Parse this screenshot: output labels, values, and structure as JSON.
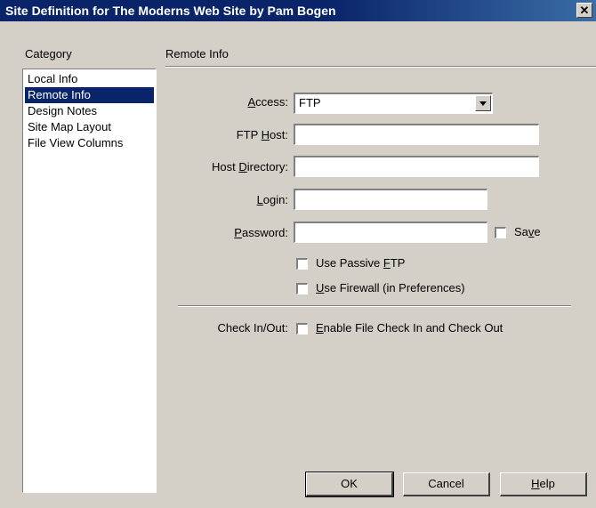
{
  "window": {
    "title": "Site Definition for The Moderns Web Site by Pam Bogen",
    "close_glyph": "✕"
  },
  "category": {
    "label": "Category",
    "items": [
      {
        "label": "Local Info",
        "selected": false
      },
      {
        "label": "Remote Info",
        "selected": true
      },
      {
        "label": "Design Notes",
        "selected": false
      },
      {
        "label": "Site Map Layout",
        "selected": false
      },
      {
        "label": "File View Columns",
        "selected": false
      }
    ]
  },
  "panel": {
    "title": "Remote Info",
    "access": {
      "label_pre": "",
      "label_key": "A",
      "label_post": "ccess:",
      "value": "FTP"
    },
    "ftp_host": {
      "label_pre": "FTP ",
      "label_key": "H",
      "label_post": "ost:",
      "value": ""
    },
    "host_directory": {
      "label_pre": "Host ",
      "label_key": "D",
      "label_post": "irectory:",
      "value": ""
    },
    "login": {
      "label_pre": "",
      "label_key": "L",
      "label_post": "ogin:",
      "value": ""
    },
    "password": {
      "label_pre": "",
      "label_key": "P",
      "label_post": "assword:",
      "value": ""
    },
    "save": {
      "label_pre": "Sa",
      "label_key": "v",
      "label_post": "e",
      "checked": false
    },
    "passive_ftp": {
      "label_pre": "Use Passive ",
      "label_key": "F",
      "label_post": "TP",
      "checked": false
    },
    "firewall": {
      "label_pre": "",
      "label_key": "U",
      "label_post": "se Firewall (in Preferences)",
      "checked": false
    },
    "checkin": {
      "label": "Check In/Out:",
      "option_pre": "",
      "option_key": "E",
      "option_post": "nable File Check In and Check Out",
      "checked": false
    }
  },
  "buttons": {
    "ok": "OK",
    "cancel": "Cancel",
    "help_pre": "",
    "help_key": "H",
    "help_post": "elp"
  }
}
